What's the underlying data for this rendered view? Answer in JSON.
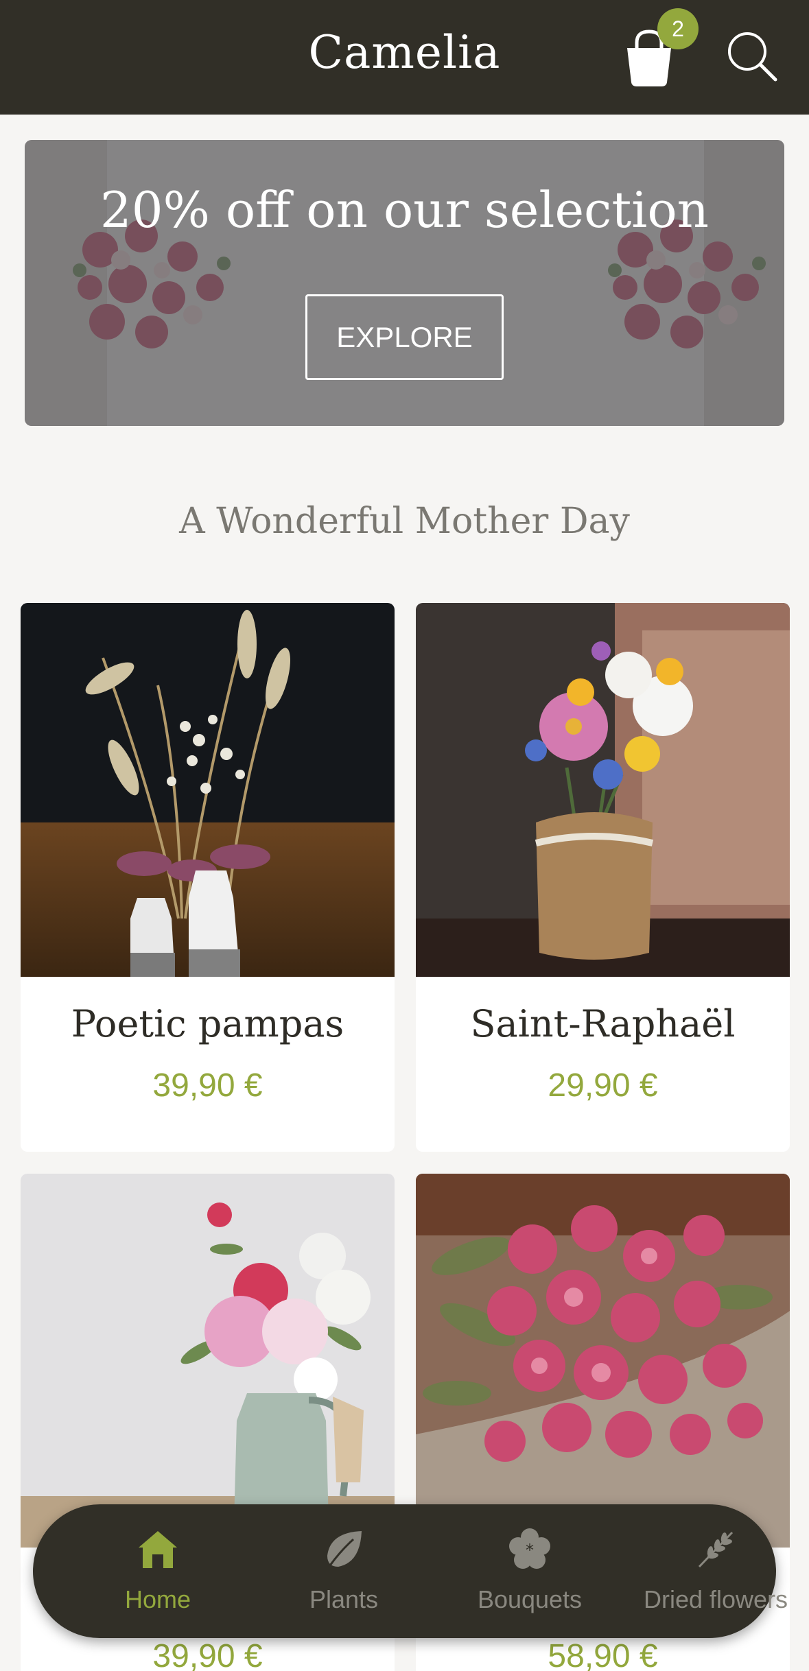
{
  "header": {
    "brand": "Camelia",
    "cart_count": "2",
    "cart_icon": "shopping-bag-icon",
    "search_icon": "search-icon"
  },
  "banner": {
    "title": "20% off on our selection",
    "button_label": "EXPLORE"
  },
  "section": {
    "title": "A Wonderful Mother Day"
  },
  "products": [
    {
      "name": "Poetic pampas",
      "price": "39,90 €"
    },
    {
      "name": "Saint-Raphaël",
      "price": "29,90 €"
    },
    {
      "name": "",
      "price": "39,90 €"
    },
    {
      "name": "",
      "price": "58,90 €"
    }
  ],
  "tabbar": {
    "items": [
      {
        "label": "Home",
        "icon": "home-icon",
        "active": true
      },
      {
        "label": "Plants",
        "icon": "leaf-icon",
        "active": false
      },
      {
        "label": "Bouquets",
        "icon": "flower-icon",
        "active": false
      },
      {
        "label": "Dried flowers",
        "icon": "wheat-icon",
        "active": false
      }
    ]
  },
  "colors": {
    "header_bg": "#312f27",
    "accent": "#93a83d",
    "background": "#f6f5f3"
  }
}
